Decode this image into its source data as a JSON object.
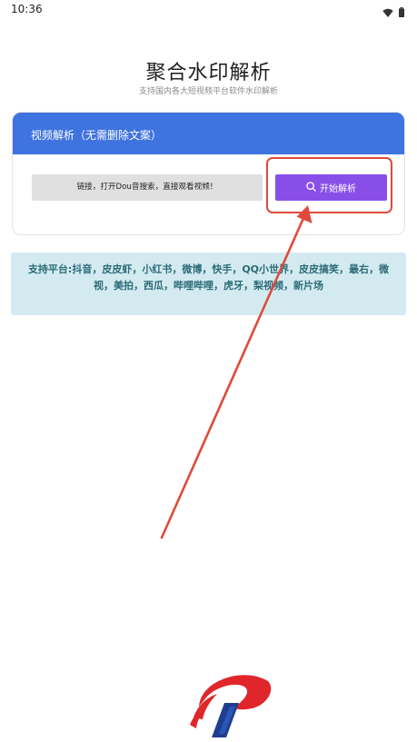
{
  "status_bar": {
    "time": "10:36",
    "icons": [
      "wifi-icon",
      "battery-icon"
    ]
  },
  "header": {
    "title": "聚合水印解析",
    "subtitle": "支持国内各大短视频平台软件水印解析"
  },
  "card": {
    "title": "视频解析（无需删除文案）",
    "input_value": "链接，打开Dou音搜索，直接观看视频！",
    "button_label": "开始解析",
    "button_icon": "search-icon"
  },
  "info": {
    "text": "支持平台:抖音，皮皮虾，小红书，微博，快手，QQ小世界，皮皮搞笑，最右，微视，美拍，西瓜，哔哩哔哩，虎牙，梨视频，新片场"
  },
  "colors": {
    "accent_header": "#3f73df",
    "button": "#8a4ee8",
    "annotation": "#e04a3a",
    "info_bg": "#d3ebf0",
    "info_text": "#2c6b78"
  }
}
